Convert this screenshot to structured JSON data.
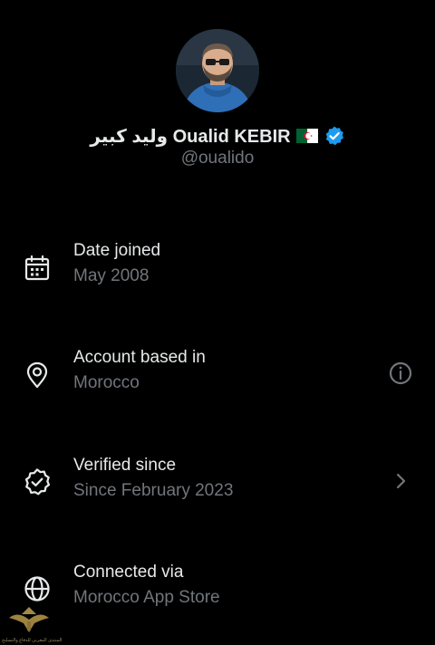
{
  "profile": {
    "display_name": "وليد كبير Oualid KEBIR",
    "handle": "@oualido",
    "flag_icon": "algeria-flag-icon",
    "verified_icon": "verified-badge-icon",
    "accent_color": "#1d9bf0"
  },
  "about": {
    "items": [
      {
        "title": "Date joined",
        "value": "May 2008",
        "icon": "calendar-icon"
      },
      {
        "title": "Account based in",
        "value": "Morocco",
        "icon": "location-pin-icon",
        "trailing_icon": "info-icon"
      },
      {
        "title": "Verified since",
        "value": "Since February 2023",
        "icon": "verified-check-icon",
        "trailing_icon": "chevron-right-icon"
      },
      {
        "title": "Connected via",
        "value": "Morocco App Store",
        "icon": "globe-icon"
      }
    ]
  },
  "watermark": {
    "text": "المنتدى المغربي للدفاع والتسليح"
  },
  "colors": {
    "background": "#000000",
    "primary_text": "#e7e9ea",
    "secondary_text": "#71767b"
  }
}
